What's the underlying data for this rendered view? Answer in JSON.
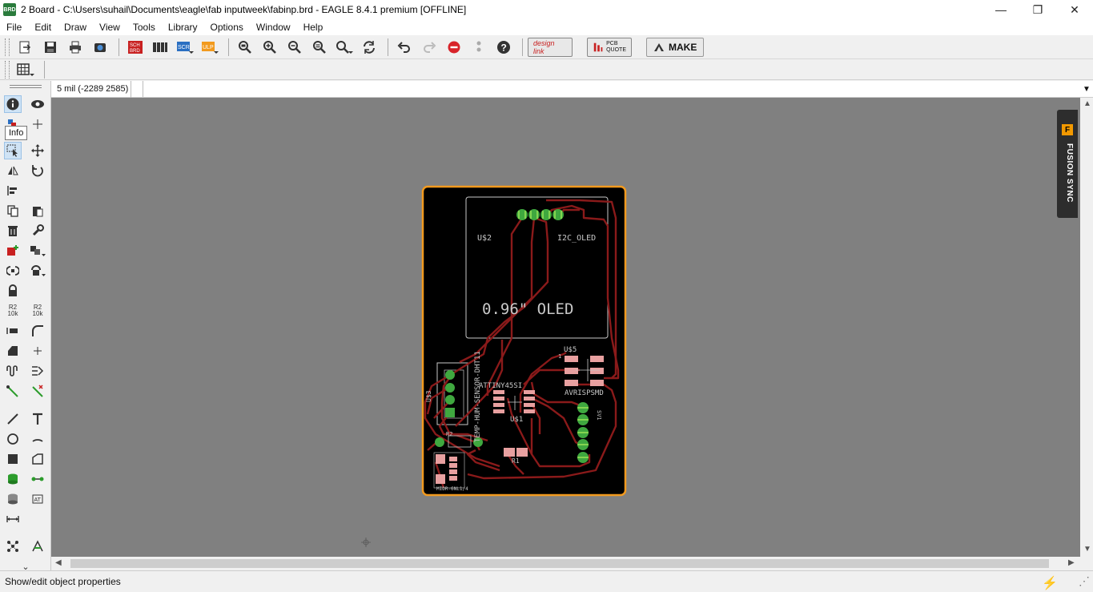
{
  "window": {
    "title": "2 Board - C:\\Users\\suhail\\Documents\\eagle\\fab inputweek\\fabinp.brd - EAGLE 8.4.1 premium [OFFLINE]",
    "icon_text": "BRD",
    "minimize": "—",
    "maximize": "❐",
    "close": "✕"
  },
  "menu": [
    "File",
    "Edit",
    "Draw",
    "View",
    "Tools",
    "Library",
    "Options",
    "Window",
    "Help"
  ],
  "toolbar": {
    "designlink_label": "design link",
    "pcbquote_label": "PCB QUOTE",
    "make_label": "MAKE"
  },
  "left_toolbar": {
    "tooltip": "Info",
    "r2_top": "R2",
    "r2_bottom": "10k"
  },
  "coordbar": {
    "coordinate": "5 mil (-2289 2585)",
    "command_placeholder": ""
  },
  "fusion_sync": {
    "logo": "F",
    "label": "FUSION SYNC"
  },
  "board": {
    "labels": {
      "u2": "U$2",
      "i2c_oled": "I2C_OLED",
      "oled_size": "0.96\" OLED",
      "u5": "U$5",
      "u5_pin": "1",
      "attiny": "ATTINY45SI",
      "u1": "U$1",
      "avrisp": "AVRISPSMD",
      "sensor": "TEMP-HUM-SENSOR-DHT11",
      "u3": "U$3",
      "r2": "R2",
      "r1": "R1",
      "sv1": "SV1",
      "footer_label": "MIDR-6NL1/4"
    },
    "colors": {
      "board_bg": "#000000",
      "outline": "#f29a1e",
      "trace": "#8a1a1a",
      "pad": "#3fa83f",
      "silk": "#c8c8c8",
      "smd": "#e8a0a0"
    }
  },
  "status": {
    "text": "Show/edit object properties"
  }
}
